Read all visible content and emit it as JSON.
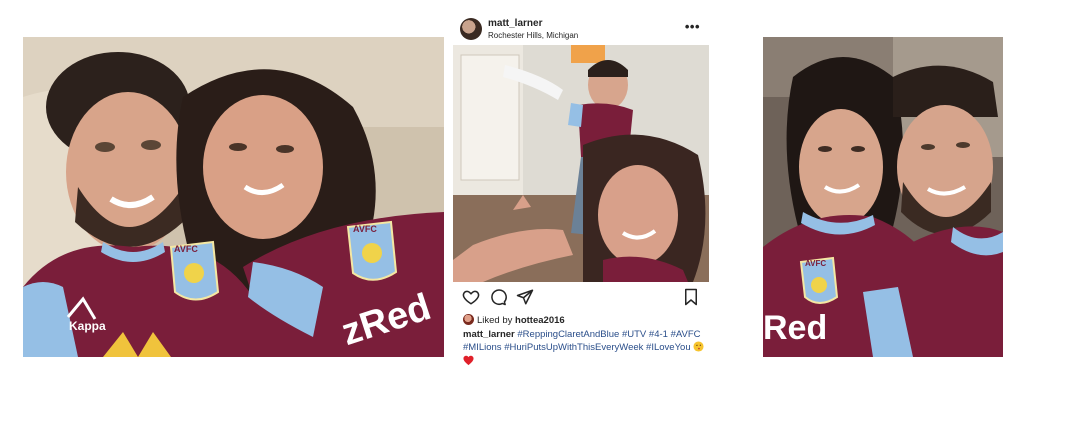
{
  "post": {
    "username": "matt_larner",
    "location": "Rochester Hills, Michigan",
    "more_label": "•••",
    "liked_prefix": "Liked by ",
    "liked_user": "hottea2016",
    "caption_user": "matt_larner",
    "hashtags": [
      "#ReppingClaretAndBlue",
      "#UTV",
      "#4-1",
      "#AVFC",
      "#MILions",
      "#HuriPutsUpWithThisEveryWeek",
      "#ILoveYou"
    ],
    "icons": [
      "heart-icon",
      "comment-icon",
      "share-icon",
      "bookmark-icon"
    ]
  },
  "shirt": {
    "badge_text": "AVFC",
    "sponsor_text": "Red",
    "sponsor_text_left": "zRed",
    "kit_brand": "Kappa"
  },
  "colors": {
    "claret": "#7a1e3a",
    "sky_blue": "#95bfe5",
    "hashtag_blue": "#2a4e8a",
    "text": "#262626"
  }
}
